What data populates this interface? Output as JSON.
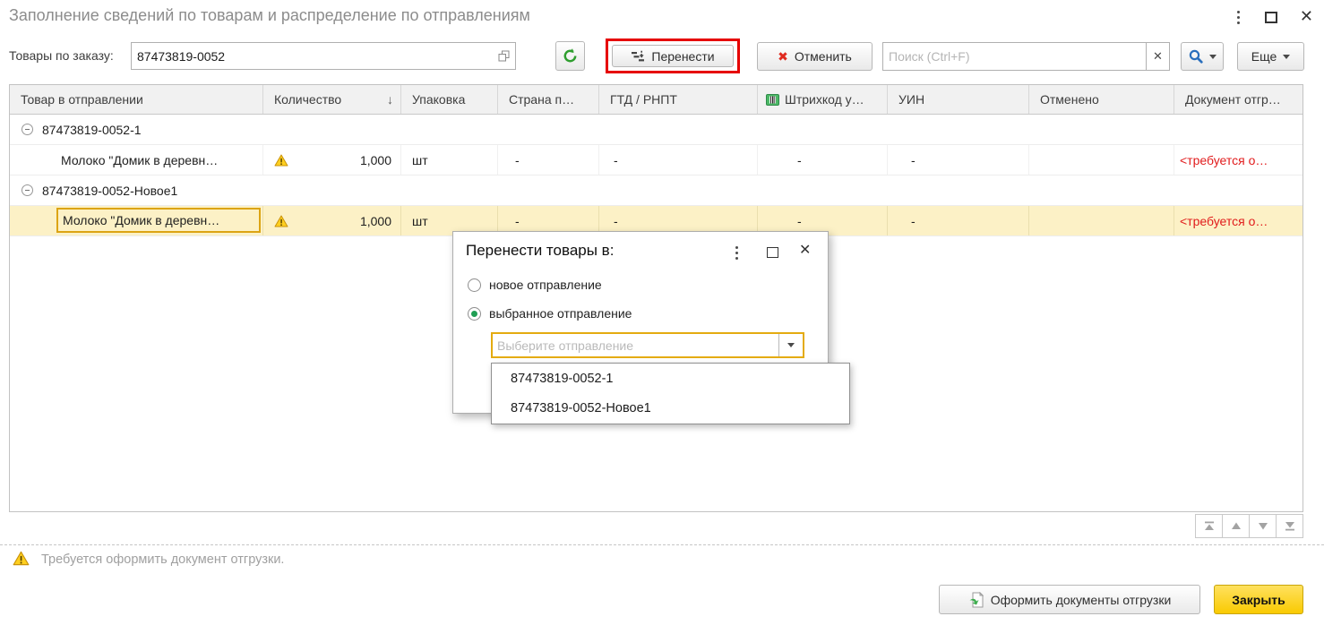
{
  "window": {
    "title": "Заполнение сведений по товарам и распределение по отправлениям"
  },
  "toolbar": {
    "order_label": "Товары по заказу:",
    "order_value": "87473819-0052",
    "transfer_label": "Перенести",
    "cancel_label": "Отменить",
    "search_placeholder": "Поиск (Ctrl+F)",
    "clear_label": "✕",
    "more_label": "Еще"
  },
  "table": {
    "columns": [
      "Товар в отправлении",
      "Количество",
      "Упаковка",
      "Страна п…",
      "ГТД / РНПТ",
      "Штрихкод у…",
      "УИН",
      "Отменено",
      "Документ отгр…"
    ],
    "sort_arrow": "↓",
    "rows": [
      {
        "type": "group",
        "label": "87473819-0052-1"
      },
      {
        "type": "item",
        "product": "Молоко \"Домик в деревн…",
        "qty": "1,000",
        "unit": "шт",
        "country": "-",
        "gtd_rnpt": "-",
        "barcode": "-",
        "uin": "-",
        "cancelled": "",
        "shipment_doc": "<требуется о…"
      },
      {
        "type": "group",
        "label": "87473819-0052-Новое1"
      },
      {
        "type": "item",
        "product": "Молоко \"Домик в деревн…",
        "qty": "1,000",
        "unit": "шт",
        "country": "-",
        "gtd_rnpt": "-",
        "barcode": "-",
        "uin": "-",
        "cancelled": "",
        "shipment_doc": "<требуется о…",
        "selected": true
      }
    ]
  },
  "dialog": {
    "title": "Перенести товары в:",
    "radio_new_label": "новое отправление",
    "radio_selected_label": "выбранное отправление",
    "selected_option": "выбранное отправление",
    "combo_placeholder": "Выберите отправление",
    "dropdown_items": [
      "87473819-0052-1",
      "87473819-0052-Новое1"
    ]
  },
  "footer": {
    "warning_text": "Требуется оформить документ отгрузки.",
    "issue_docs_label": "Оформить документы отгрузки",
    "close_label": "Закрыть"
  },
  "colors": {
    "annotation_red": "#e60000",
    "selected_row_yellow": "#fcf1c6",
    "focus_cell_border": "#dca414",
    "error_text_red": "#e11c1c",
    "close_button_yellow": "#f9ca02",
    "refresh_green": "#2f9e2f",
    "search_blue": "#2a6fbd",
    "warning_yellow": "#ffcf1f"
  }
}
